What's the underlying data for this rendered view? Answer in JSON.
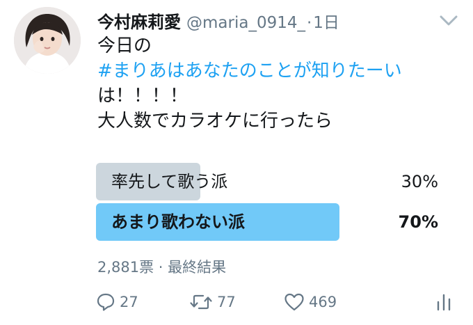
{
  "tweet": {
    "author_name": "今村麻莉愛",
    "handle": "@maria_0914_",
    "separator": "·",
    "time": "1日",
    "text_line1": "今日の",
    "hashtag": "#まりあはあなたのことが知りたーい",
    "text_line3": "は！！！！",
    "text_line4": "大人数でカラオケに行ったら"
  },
  "poll": {
    "options": [
      {
        "label": "率先して歌う派",
        "percent_text": "30%",
        "percent": 30,
        "winner": false
      },
      {
        "label": "あまり歌わない派",
        "percent_text": "70%",
        "percent": 70,
        "winner": true
      }
    ],
    "meta": "2,881票 · 最終結果"
  },
  "actions": {
    "replies": "27",
    "retweets": "77",
    "likes": "469"
  },
  "icons": {
    "reply": "reply-icon",
    "retweet": "retweet-icon",
    "like": "heart-icon",
    "analytics": "analytics-icon",
    "menu": "chevron-down-icon"
  },
  "colors": {
    "hashtag": "#1da1f2",
    "poll_winner": "#71c9f8",
    "poll_other": "#ccd6dd",
    "secondary_text": "#657786"
  }
}
